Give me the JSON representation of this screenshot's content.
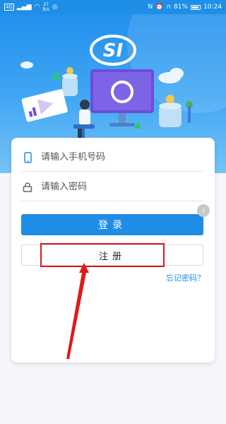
{
  "status_bar": {
    "network": "4G",
    "speed_value": "27",
    "speed_unit": "B/s",
    "battery": "81%",
    "time": "10:24"
  },
  "logo": {
    "text": "SI"
  },
  "login": {
    "phone_placeholder": "请输入手机号码",
    "password_placeholder": "请输入密码",
    "login_label": "登录",
    "register_label": "注册",
    "forgot_label": "忘记密码？"
  },
  "colors": {
    "primary": "#1f8ce6",
    "annotation": "#e01919"
  }
}
